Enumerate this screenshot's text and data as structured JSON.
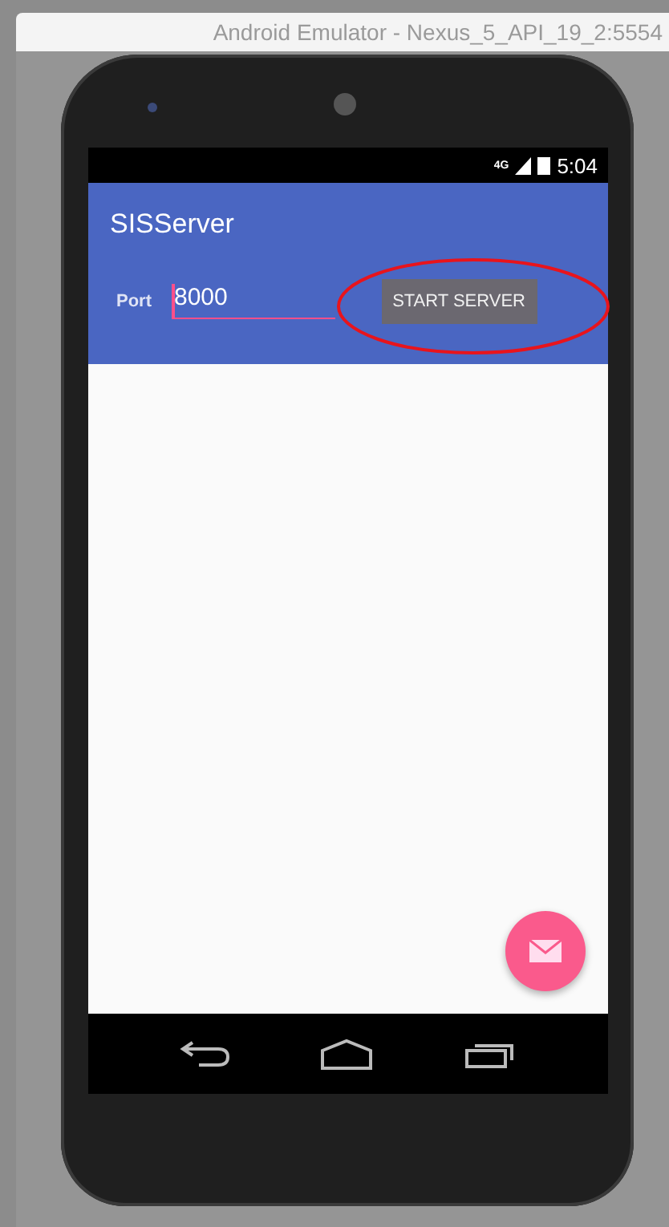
{
  "window": {
    "title": "Android Emulator - Nexus_5_API_19_2:5554"
  },
  "status_bar": {
    "network": "4G",
    "time": "5:04"
  },
  "app_bar": {
    "title": "SISServer"
  },
  "port": {
    "label": "Port",
    "value": "8000"
  },
  "start_button": {
    "label": "START SERVER",
    "highlighted": true
  }
}
